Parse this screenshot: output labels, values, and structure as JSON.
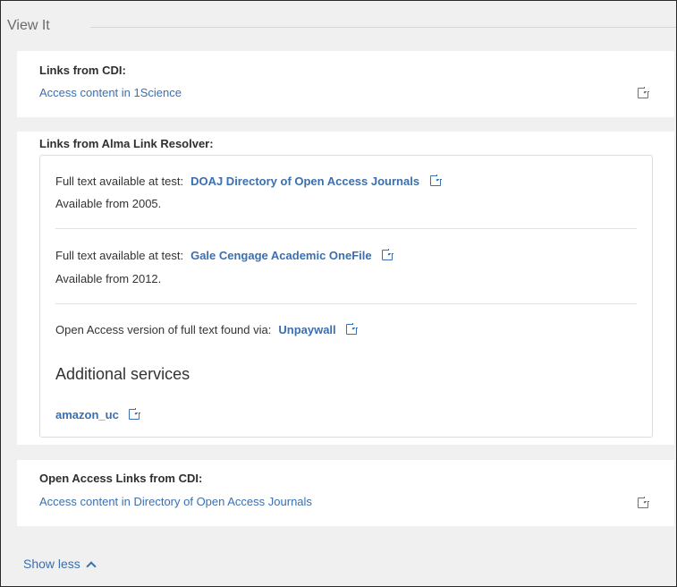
{
  "panel": {
    "title": "View It"
  },
  "cdi": {
    "heading": "Links from CDI:",
    "link": "Access content in 1Science"
  },
  "alma": {
    "heading": "Links from Alma Link Resolver:",
    "services": [
      {
        "label": "Full text available at test:",
        "link": "DOAJ Directory of Open Access Journals",
        "availability": "Available from 2005."
      },
      {
        "label": "Full text available at test:",
        "link": "Gale Cengage Academic OneFile",
        "availability": "Available from 2012."
      },
      {
        "label": "Open Access version of full text found via:",
        "link": "Unpaywall"
      }
    ],
    "additional_heading": "Additional services",
    "additional_link": "amazon_uc"
  },
  "oa_cdi": {
    "heading": "Open Access Links from CDI:",
    "link": "Access content in Directory of Open Access Journals"
  },
  "footer": {
    "show_less": "Show less"
  }
}
